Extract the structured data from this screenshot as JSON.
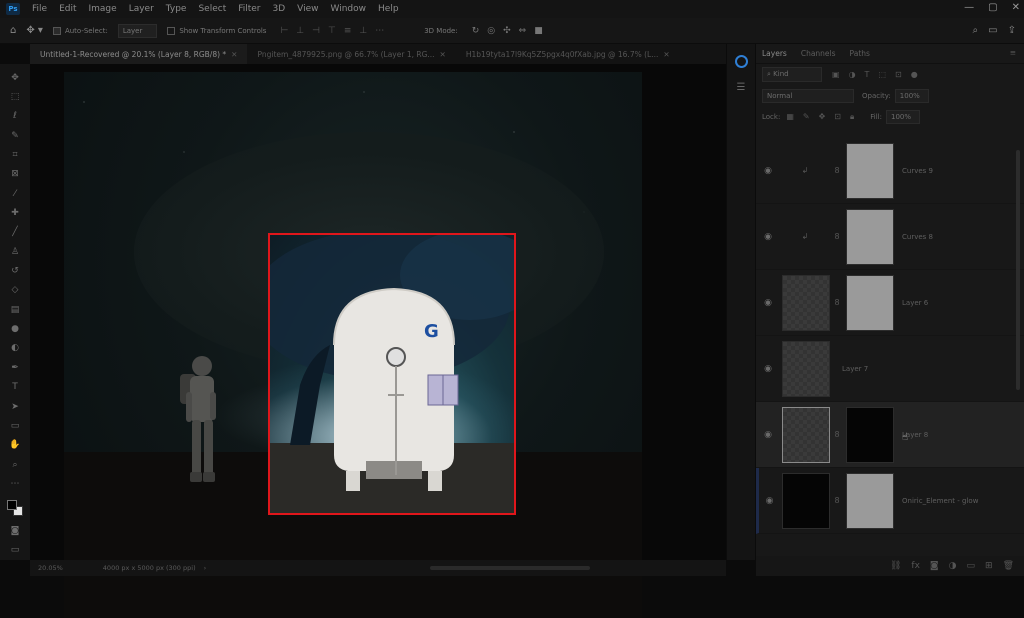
{
  "app": {
    "logo": "Ps"
  },
  "menu": [
    "File",
    "Edit",
    "Image",
    "Layer",
    "Type",
    "Select",
    "Filter",
    "3D",
    "View",
    "Window",
    "Help"
  ],
  "window_controls": [
    "—",
    "▢",
    "✕"
  ],
  "options": {
    "auto_select_label": "Auto-Select:",
    "auto_select_value": "Layer",
    "transform_label": "Show Transform Controls",
    "mode_3d": "3D Mode:"
  },
  "tabs": [
    {
      "label": "Untitled-1-Recovered @ 20.1% (Layer 8, RGB/8) *",
      "active": true
    },
    {
      "label": "Pngitem_4879925.png @ 66.7% (Layer 1, RG...",
      "active": false
    },
    {
      "label": "H1b19tyta17l9Kq5Z5pgx4q0fXab.jpg @ 16.7% (L...",
      "active": false
    }
  ],
  "tools": [
    "move-icon",
    "marquee-icon",
    "lasso-icon",
    "quick-select-icon",
    "crop-icon",
    "frame-icon",
    "eyedropper-icon",
    "healing-icon",
    "brush-icon",
    "stamp-icon",
    "history-brush-icon",
    "eraser-icon",
    "gradient-icon",
    "blur-icon",
    "dodge-icon",
    "pen-icon",
    "type-icon",
    "path-select-icon",
    "shape-icon",
    "hand-icon",
    "zoom-icon",
    "more-icon"
  ],
  "layers_panel": {
    "tabs": [
      "Layers",
      "Channels",
      "Paths"
    ],
    "filter_label": "Kind",
    "blend_mode": "Normal",
    "opacity_label": "Opacity:",
    "opacity_value": "100%",
    "lock_label": "Lock:",
    "fill_label": "Fill:",
    "fill_value": "100%",
    "layers": [
      {
        "name": "Curves 9",
        "kind": "adjustment",
        "selected": false
      },
      {
        "name": "Curves 8",
        "kind": "adjustment",
        "selected": false
      },
      {
        "name": "Layer 6",
        "kind": "masked-transparent",
        "selected": false
      },
      {
        "name": "Layer 7",
        "kind": "transparent",
        "selected": false
      },
      {
        "name": "Layer 8",
        "kind": "masked-black",
        "selected": true
      },
      {
        "name": "Oniric_Element - glow",
        "kind": "black-with-mask",
        "selected": false
      }
    ]
  },
  "status": {
    "zoom": "20.05%",
    "doc_size": "4000 px x 5000 px (300 ppi)"
  },
  "colors": {
    "selection_border": "#e0161b",
    "accent": "#2f7fd5"
  }
}
